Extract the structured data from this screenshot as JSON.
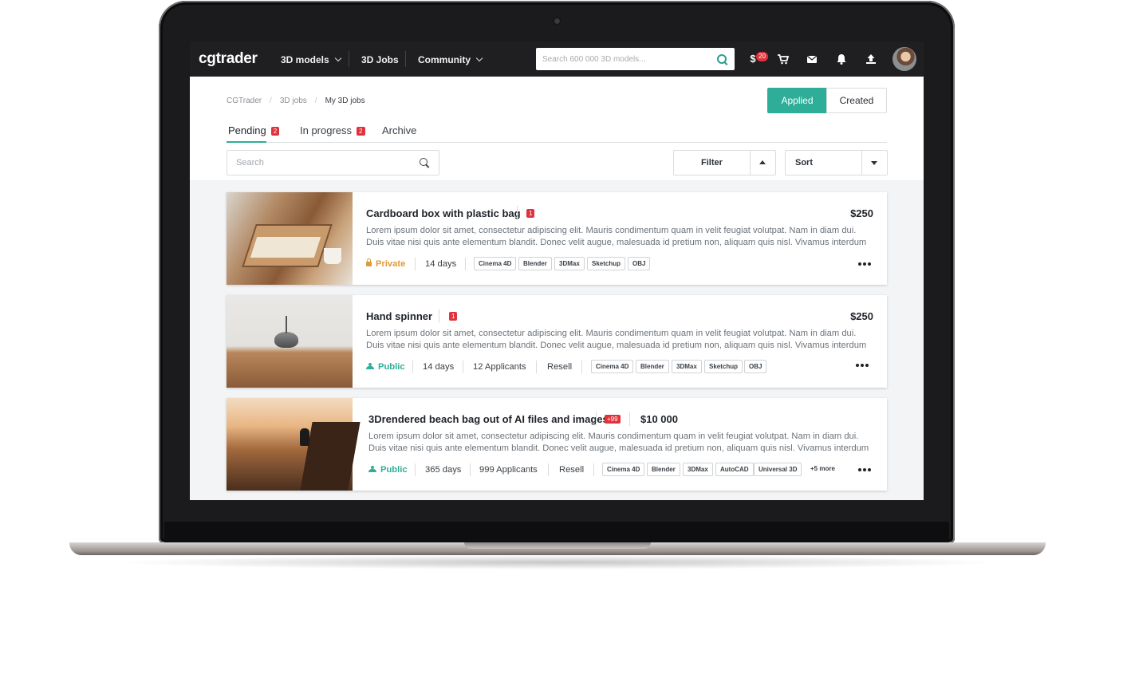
{
  "nav": {
    "logo": "cgtrader",
    "items": [
      "3D models",
      "3D Jobs",
      "Community"
    ],
    "search_placeholder": "Search 600 000 3D models...",
    "money_icon": "$",
    "money_badge": "20"
  },
  "breadcrumb": [
    "CGTrader",
    "3D jobs",
    "My 3D jobs"
  ],
  "toggle": {
    "applied": "Applied",
    "created": "Created"
  },
  "tabs": [
    {
      "label": "Pending",
      "badge": "2"
    },
    {
      "label": "In progress",
      "badge": "2"
    },
    {
      "label": "Archive"
    }
  ],
  "controls": {
    "search_placeholder": "Search",
    "filter": "Filter",
    "sort": "Sort"
  },
  "jobs": [
    {
      "title": "Cardboard box with plastic bag",
      "badge": "1",
      "price": "$250",
      "desc1": "Lorem ipsum dolor sit amet, consectetur adipiscing elit. Mauris condimentum quam in velit feugiat volutpat. Nam in diam dui.",
      "desc2": "Duis vitae nisi quis ante elementum blandit. Donec velit augue, malesuada id pretium non, aliquam quis nisl. Vivamus interdum",
      "visibility": "Private",
      "duration": "14 days",
      "tags": [
        "Cinema 4D",
        "Blender",
        "3DMax",
        "Sketchup",
        "OBJ"
      ]
    },
    {
      "title": "Hand spinner",
      "badge": "1",
      "price": "$250",
      "desc1": "Lorem ipsum dolor sit amet, consectetur adipiscing elit. Mauris condimentum quam in velit feugiat volutpat. Nam in diam dui.",
      "desc2": "Duis vitae nisi quis ante elementum blandit. Donec velit augue, malesuada id pretium non, aliquam quis nisl. Vivamus interdum",
      "visibility": "Public",
      "duration": "14 days",
      "applicants": "12 Applicants",
      "resell": "Resell",
      "tags": [
        "Cinema 4D",
        "Blender",
        "3DMax",
        "Sketchup",
        "OBJ"
      ]
    },
    {
      "title": "3Drendered beach bag out of AI files and images",
      "badge": "+99",
      "price": "$10 000",
      "desc1": "Lorem ipsum dolor sit amet, consectetur adipiscing elit. Mauris condimentum quam in velit feugiat volutpat. Nam in diam dui.",
      "desc2": "Duis vitae nisi quis ante elementum blandit. Donec velit augue, malesuada id pretium non, aliquam quis nisl. Vivamus interdum",
      "visibility": "Public",
      "duration": "365 days",
      "applicants": "999 Applicants",
      "resell": "Resell",
      "tags": [
        "Cinema 4D",
        "Blender",
        "3DMax",
        "AutoCAD",
        "Universal 3D"
      ],
      "more_tags": "+5 more"
    }
  ],
  "colors": {
    "accent": "#2eae98",
    "badge": "#e0323c",
    "private": "#e09a3a",
    "nav_bg": "#1f1f22"
  }
}
